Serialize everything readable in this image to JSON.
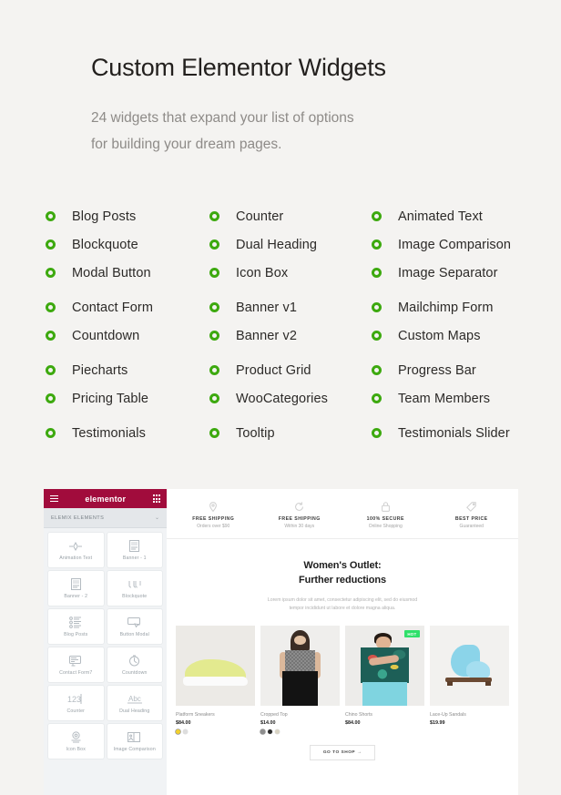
{
  "hero": {
    "title": "Custom Elementor Widgets",
    "subtitle_line1": "24 widgets that expand your list of options",
    "subtitle_line2": "for building your dream pages."
  },
  "widget_columns": [
    {
      "items": [
        {
          "label": "Blog Posts"
        },
        {
          "label": "Blockquote"
        },
        {
          "label": "Modal Button"
        },
        {
          "label": "Contact Form"
        },
        {
          "label": "Countdown"
        },
        {
          "label": "Piecharts"
        },
        {
          "label": "Pricing Table"
        },
        {
          "label": "Testimonials"
        }
      ]
    },
    {
      "items": [
        {
          "label": "Counter"
        },
        {
          "label": "Dual Heading"
        },
        {
          "label": "Icon Box"
        },
        {
          "label": "Banner v1"
        },
        {
          "label": "Banner v2"
        },
        {
          "label": "Product Grid"
        },
        {
          "label": "WooCategories"
        },
        {
          "label": "Tooltip"
        }
      ]
    },
    {
      "items": [
        {
          "label": "Animated Text"
        },
        {
          "label": "Image Comparison"
        },
        {
          "label": "Image Separator"
        },
        {
          "label": "Mailchimp Form"
        },
        {
          "label": "Custom Maps"
        },
        {
          "label": "Progress Bar"
        },
        {
          "label": "Team Members"
        },
        {
          "label": "Testimonials Slider"
        }
      ]
    }
  ],
  "bullet_color": "#3da90f",
  "editor_screenshot": {
    "panel": {
      "brand": "elementor",
      "brand_bar_color": "#a10c3c",
      "menu_icon": "hamburger-icon",
      "grid_icon": "grid-icon",
      "section_label": "ELEMIX ELEMENTS",
      "section_chevron": "chevron-down-icon",
      "tiles": [
        {
          "label": "Animation Text",
          "icon": "animation-text-icon"
        },
        {
          "label": "Banner - 1",
          "icon": "banner-one-icon"
        },
        {
          "label": "Banner - 2",
          "icon": "banner-two-icon"
        },
        {
          "label": "Blockquote",
          "icon": "quote-icon"
        },
        {
          "label": "Blog Posts",
          "icon": "blog-posts-icon"
        },
        {
          "label": "Button Modal",
          "icon": "button-modal-icon"
        },
        {
          "label": "Contact Form7",
          "icon": "contact-form-icon"
        },
        {
          "label": "Countdown",
          "icon": "countdown-icon"
        },
        {
          "label": "Counter",
          "icon": "counter-icon"
        },
        {
          "label": "Dual Heading",
          "icon": "dual-heading-icon"
        },
        {
          "label": "Icon Box",
          "icon": "icon-box-icon"
        },
        {
          "label": "Image Comparison",
          "icon": "image-comparison-icon"
        }
      ]
    },
    "preview": {
      "features": [
        {
          "title": "FREE SHIPPING",
          "subtitle": "Orders over $90",
          "icon": "pin-icon"
        },
        {
          "title": "FREE SHIPPING",
          "subtitle": "Within 30 days",
          "icon": "refresh-icon"
        },
        {
          "title": "100% SECURE",
          "subtitle": "Online Shopping",
          "icon": "lock-icon"
        },
        {
          "title": "BEST PRICE",
          "subtitle": "Guaranteed",
          "icon": "tag-icon"
        }
      ],
      "heading_line1": "Women's Outlet:",
      "heading_line2": "Further reductions",
      "paragraph_line1": "Lorem ipsum dolor sit amet, consectetur adipiscing elit, sed do eiusmod",
      "paragraph_line2": "tempor incididunt ut labore et dolore magna aliqua.",
      "products": [
        {
          "name": "Platform Sneakers",
          "price": "$84.00",
          "badge": "",
          "swatches": [
            "#f2d02c",
            "#dddddd"
          ]
        },
        {
          "name": "Cropped Top",
          "price": "$14.00",
          "badge": "",
          "swatches": [
            "#8e8e8e",
            "#2b2b2b",
            "#d9d4c4"
          ]
        },
        {
          "name": "Chino Shorts",
          "price": "$84.00",
          "badge": "HOT",
          "badge_color": "#2fe06a",
          "swatches": []
        },
        {
          "name": "Lace-Up Sandals",
          "price": "$19.99",
          "badge": "",
          "swatches": []
        }
      ],
      "shop_button": "GO TO SHOP  →"
    }
  }
}
